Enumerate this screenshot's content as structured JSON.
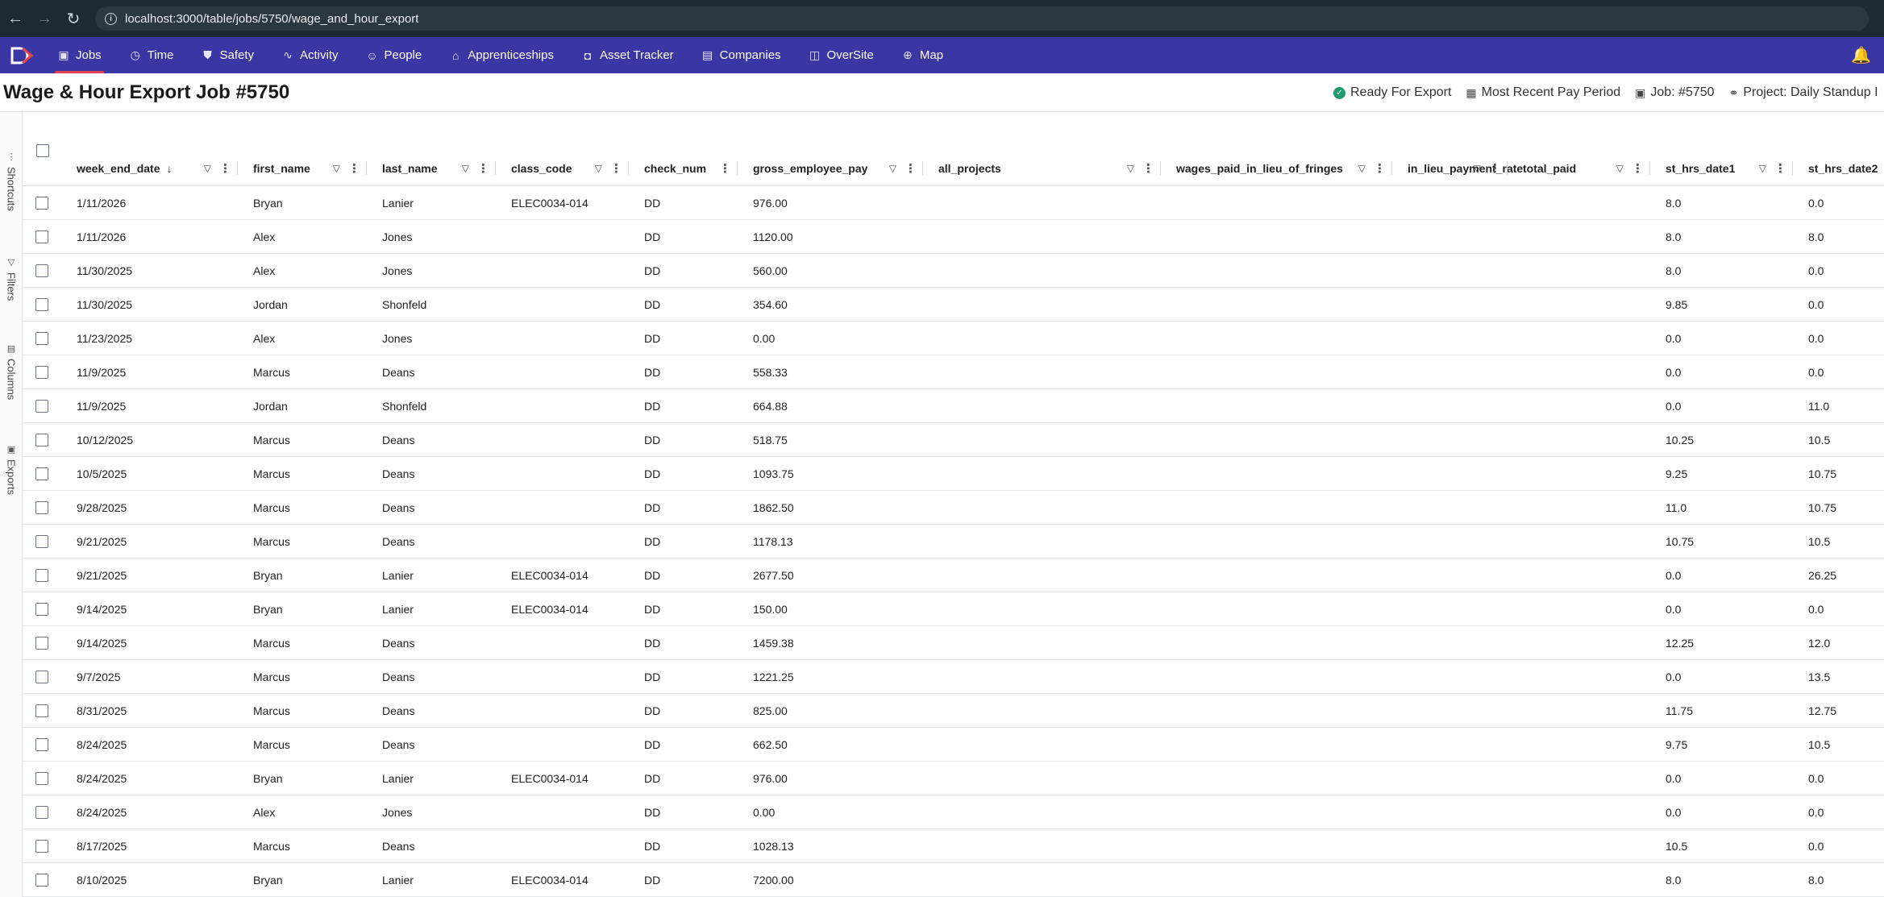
{
  "browser": {
    "url": "localhost:3000/table/jobs/5750/wage_and_hour_export"
  },
  "nav": {
    "items": [
      {
        "label": "Jobs",
        "icon": "briefcase-icon",
        "glyph": "▣",
        "active": true
      },
      {
        "label": "Time",
        "icon": "clock-icon",
        "glyph": "◷",
        "active": false
      },
      {
        "label": "Safety",
        "icon": "shield-icon",
        "glyph": "⛊",
        "active": false
      },
      {
        "label": "Activity",
        "icon": "pulse-icon",
        "glyph": "∿",
        "active": false
      },
      {
        "label": "People",
        "icon": "people-icon",
        "glyph": "☺",
        "active": false
      },
      {
        "label": "Apprenticeships",
        "icon": "graduation-cap-icon",
        "glyph": "⌂",
        "active": false
      },
      {
        "label": "Asset Tracker",
        "icon": "camera-icon",
        "glyph": "◘",
        "active": false
      },
      {
        "label": "Companies",
        "icon": "building-icon",
        "glyph": "▤",
        "active": false
      },
      {
        "label": "OverSite",
        "icon": "map-fold-icon",
        "glyph": "◫",
        "active": false
      },
      {
        "label": "Map",
        "icon": "globe-icon",
        "glyph": "⊕",
        "active": false
      }
    ]
  },
  "header": {
    "title": "Wage & Hour Export Job #5750",
    "chips": [
      {
        "label": "Ready For Export",
        "icon": "check-circle-icon"
      },
      {
        "label": "Most Recent Pay Period",
        "icon": "calendar-icon"
      },
      {
        "label": "Job: #5750",
        "icon": "briefcase-icon"
      },
      {
        "label": "Project: Daily Standup I",
        "icon": "project-icon"
      }
    ]
  },
  "rail": {
    "items": [
      {
        "label": "Shortcuts",
        "icon": "more-vertical-icon"
      },
      {
        "label": "Filters",
        "icon": "filter-icon"
      },
      {
        "label": "Columns",
        "icon": "columns-icon"
      },
      {
        "label": "Exports",
        "icon": "excel-icon"
      }
    ]
  },
  "table": {
    "columns": [
      {
        "key": "week_end_date",
        "label": "week_end_date",
        "sort": "desc",
        "filter": true
      },
      {
        "key": "first_name",
        "label": "first_name",
        "filter": true
      },
      {
        "key": "last_name",
        "label": "last_name",
        "filter": true
      },
      {
        "key": "class_code",
        "label": "class_code",
        "filter": true
      },
      {
        "key": "check_num",
        "label": "check_num",
        "filter": false
      },
      {
        "key": "gross_employee_pay",
        "label": "gross_employee_pay",
        "filter": true
      },
      {
        "key": "all_projects",
        "label": "all_projects",
        "filter": true
      },
      {
        "key": "wages_paid_in_lieu_of_fringes",
        "label": "wages_paid_in_lieu_of_fringes",
        "filter": true
      },
      {
        "key": "in_lieu_payment_rate",
        "label": "in_lieu_payment_rate",
        "filter": true
      },
      {
        "key": "total_paid",
        "label": "total_paid",
        "filter": true
      },
      {
        "key": "st_hrs_date1",
        "label": "st_hrs_date1",
        "filter": true
      },
      {
        "key": "st_hrs_date2",
        "label": "st_hrs_date2",
        "filter": true
      }
    ],
    "rows": [
      [
        "1/11/2026",
        "Bryan",
        "Lanier",
        "ELEC0034-014",
        "DD",
        "976.00",
        "",
        "",
        "",
        "",
        "8.0",
        "0.0"
      ],
      [
        "1/11/2026",
        "Alex",
        "Jones",
        "",
        "DD",
        "1120.00",
        "",
        "",
        "",
        "",
        "8.0",
        "8.0"
      ],
      [
        "11/30/2025",
        "Alex",
        "Jones",
        "",
        "DD",
        "560.00",
        "",
        "",
        "",
        "",
        "8.0",
        "0.0"
      ],
      [
        "11/30/2025",
        "Jordan",
        "Shonfeld",
        "",
        "DD",
        "354.60",
        "",
        "",
        "",
        "",
        "9.85",
        "0.0"
      ],
      [
        "11/23/2025",
        "Alex",
        "Jones",
        "",
        "DD",
        "0.00",
        "",
        "",
        "",
        "",
        "0.0",
        "0.0"
      ],
      [
        "11/9/2025",
        "Marcus",
        "Deans",
        "",
        "DD",
        "558.33",
        "",
        "",
        "",
        "",
        "0.0",
        "0.0"
      ],
      [
        "11/9/2025",
        "Jordan",
        "Shonfeld",
        "",
        "DD",
        "664.88",
        "",
        "",
        "",
        "",
        "0.0",
        "11.0"
      ],
      [
        "10/12/2025",
        "Marcus",
        "Deans",
        "",
        "DD",
        "518.75",
        "",
        "",
        "",
        "",
        "10.25",
        "10.5"
      ],
      [
        "10/5/2025",
        "Marcus",
        "Deans",
        "",
        "DD",
        "1093.75",
        "",
        "",
        "",
        "",
        "9.25",
        "10.75"
      ],
      [
        "9/28/2025",
        "Marcus",
        "Deans",
        "",
        "DD",
        "1862.50",
        "",
        "",
        "",
        "",
        "11.0",
        "10.75"
      ],
      [
        "9/21/2025",
        "Marcus",
        "Deans",
        "",
        "DD",
        "1178.13",
        "",
        "",
        "",
        "",
        "10.75",
        "10.5"
      ],
      [
        "9/21/2025",
        "Bryan",
        "Lanier",
        "ELEC0034-014",
        "DD",
        "2677.50",
        "",
        "",
        "",
        "",
        "0.0",
        "26.25"
      ],
      [
        "9/14/2025",
        "Bryan",
        "Lanier",
        "ELEC0034-014",
        "DD",
        "150.00",
        "",
        "",
        "",
        "",
        "0.0",
        "0.0"
      ],
      [
        "9/14/2025",
        "Marcus",
        "Deans",
        "",
        "DD",
        "1459.38",
        "",
        "",
        "",
        "",
        "12.25",
        "12.0"
      ],
      [
        "9/7/2025",
        "Marcus",
        "Deans",
        "",
        "DD",
        "1221.25",
        "",
        "",
        "",
        "",
        "0.0",
        "13.5"
      ],
      [
        "8/31/2025",
        "Marcus",
        "Deans",
        "",
        "DD",
        "825.00",
        "",
        "",
        "",
        "",
        "11.75",
        "12.75"
      ],
      [
        "8/24/2025",
        "Marcus",
        "Deans",
        "",
        "DD",
        "662.50",
        "",
        "",
        "",
        "",
        "9.75",
        "10.5"
      ],
      [
        "8/24/2025",
        "Bryan",
        "Lanier",
        "ELEC0034-014",
        "DD",
        "976.00",
        "",
        "",
        "",
        "",
        "0.0",
        "0.0"
      ],
      [
        "8/24/2025",
        "Alex",
        "Jones",
        "",
        "DD",
        "0.00",
        "",
        "",
        "",
        "",
        "0.0",
        "0.0"
      ],
      [
        "8/17/2025",
        "Marcus",
        "Deans",
        "",
        "DD",
        "1028.13",
        "",
        "",
        "",
        "",
        "10.5",
        "0.0"
      ],
      [
        "8/10/2025",
        "Bryan",
        "Lanier",
        "ELEC0034-014",
        "DD",
        "7200.00",
        "",
        "",
        "",
        "",
        "8.0",
        "8.0"
      ]
    ]
  }
}
